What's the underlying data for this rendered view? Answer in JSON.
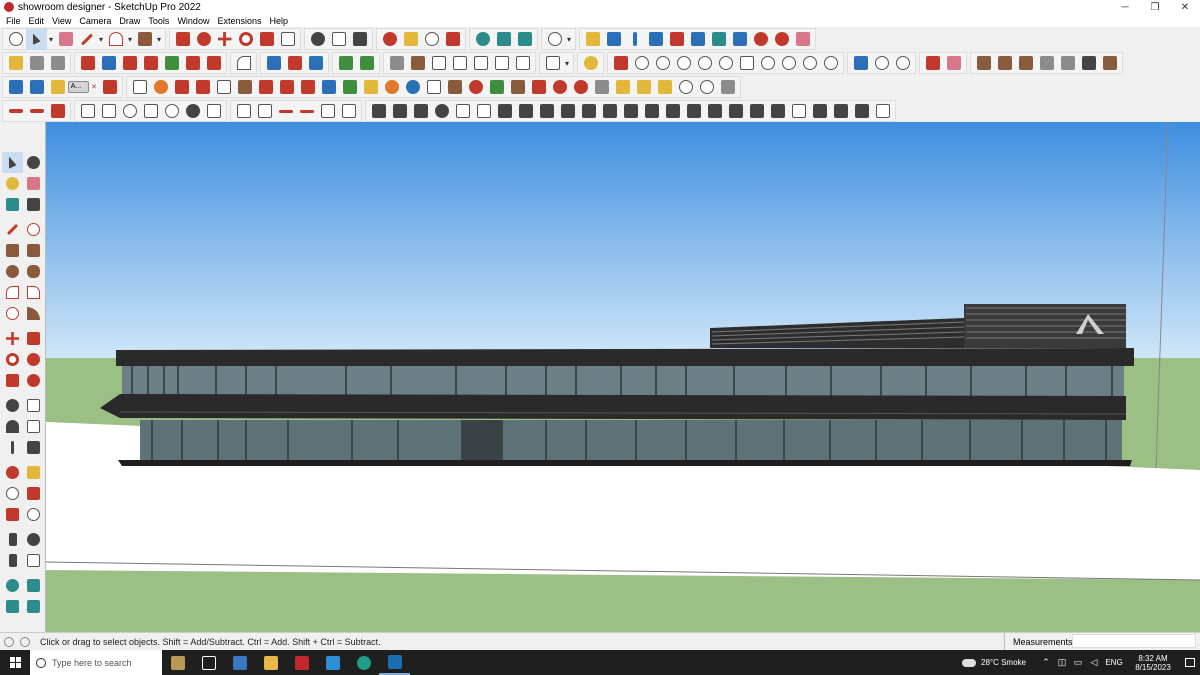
{
  "window": {
    "title": "showroom designer - SketchUp Pro 2022",
    "minimize": "─",
    "restore": "❐",
    "close": "✕"
  },
  "menu": [
    "File",
    "Edit",
    "View",
    "Camera",
    "Draw",
    "Tools",
    "Window",
    "Extensions",
    "Help"
  ],
  "toolbar": {
    "mini_chip_label": "A...",
    "mini_chip_close": "✕"
  },
  "icons": {
    "row1": [
      "zoom-icon",
      "select-icon",
      "eraser-icon",
      "line-icon",
      "arc-icon",
      "rectangle-icon",
      "push-pull-icon",
      "follow-me-icon",
      "move-icon",
      "rotate-icon",
      "scale-icon",
      "tape-measure-icon",
      "text-icon",
      "paint-bucket-icon",
      "orbit-icon",
      "pan-icon",
      "zoom-window-icon",
      "zoom-extents-icon",
      "outliner-icon",
      "layers-icon",
      "styles-icon",
      "user-icon",
      "section-plane-icon",
      "section-fill-icon",
      "axes-icon",
      "dimension-icon",
      "protractor-icon",
      "walk-icon",
      "look-around-icon",
      "position-camera-icon",
      "undo-icon",
      "redo-icon",
      "export-icon"
    ],
    "colors": {
      "sky_top": "#3f8ee0",
      "sky_bottom": "#cfe6f7",
      "ground": "#9cbf86",
      "building": "#2b2b2b",
      "glass": "#6d7f86",
      "taskbar": "#1f1f1f"
    }
  },
  "status": {
    "hint": "Click or drag to select objects. Shift = Add/Subtract. Ctrl = Add. Shift + Ctrl = Subtract.",
    "measurements_label": "Measurements"
  },
  "taskbar": {
    "search_placeholder": "Type here to search",
    "weather": "28°C  Smoke",
    "language": "ENG",
    "time": "8:32 AM",
    "date": "8/15/2023"
  }
}
